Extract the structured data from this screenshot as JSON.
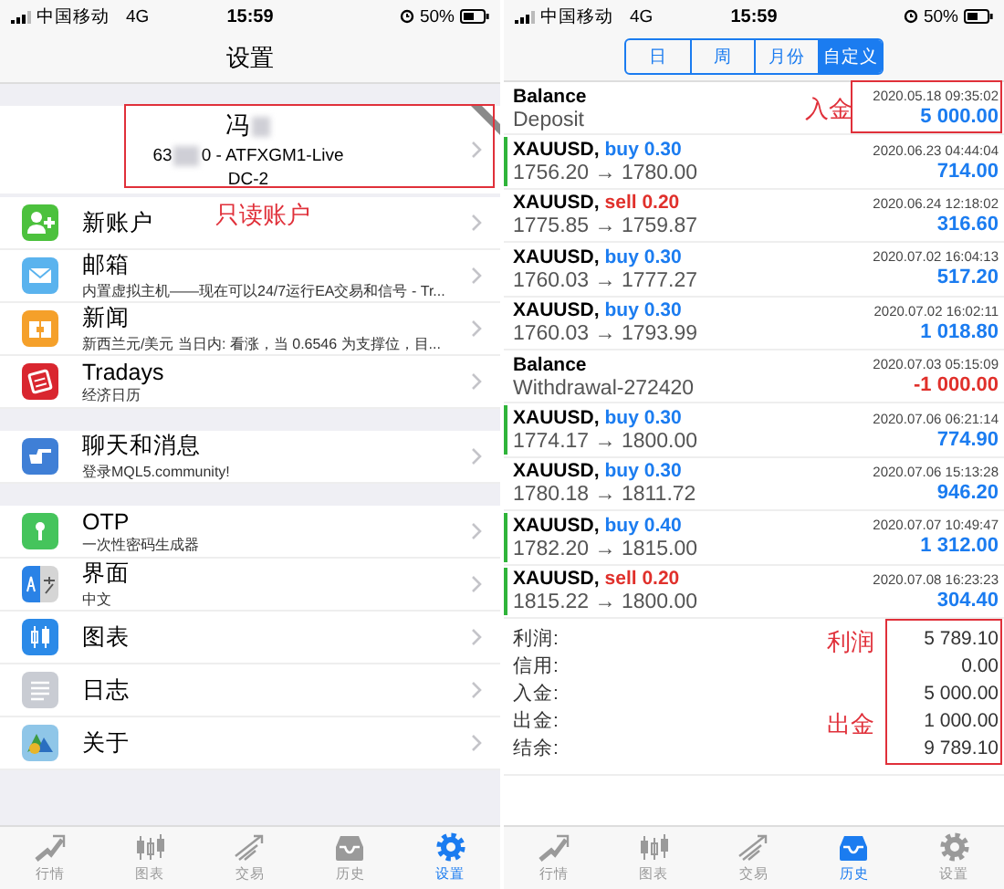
{
  "left_screen": {
    "status_bar": {
      "carrier": "中国移动",
      "network": "4G",
      "time": "15:59",
      "battery": "50%"
    },
    "title": "设置",
    "account": {
      "name": "冯",
      "number_start": "63",
      "number_end": "0 - ATFXGM1-Live",
      "server": "DC-2"
    },
    "account_note": "只读账户",
    "groups": [
      [
        {
          "kind": "new-account",
          "title": "新账户"
        },
        {
          "kind": "mail",
          "title": "邮箱",
          "subtitle": "内置虚拟主机——现在可以24/7运行EA交易和信号 - Tr..."
        },
        {
          "kind": "news",
          "title": "新闻",
          "subtitle": "新西兰元/美元 当日内: 看涨，当 0.6546 为支撑位，目..."
        },
        {
          "kind": "tradays",
          "title": "Tradays",
          "subtitle": "经济日历"
        }
      ],
      [
        {
          "kind": "chat",
          "title": "聊天和消息",
          "subtitle": "登录MQL5.community!"
        }
      ],
      [
        {
          "kind": "otp",
          "title": "OTP",
          "subtitle": "一次性密码生成器"
        },
        {
          "kind": "language",
          "title": "界面",
          "subtitle": "中文"
        },
        {
          "kind": "chart",
          "title": "图表"
        },
        {
          "kind": "log",
          "title": "日志"
        },
        {
          "kind": "about",
          "title": "关于"
        }
      ]
    ],
    "tab_bar": [
      {
        "kind": "market",
        "label": "行情",
        "selected": false
      },
      {
        "kind": "chart",
        "label": "图表",
        "selected": false
      },
      {
        "kind": "trade",
        "label": "交易",
        "selected": false
      },
      {
        "kind": "history",
        "label": "历史",
        "selected": false
      },
      {
        "kind": "settings",
        "label": "设置",
        "selected": true
      }
    ]
  },
  "right_screen": {
    "status_bar": {
      "carrier": "中国移动",
      "network": "4G",
      "time": "15:59",
      "battery": "50%"
    },
    "periods": [
      {
        "label": "日",
        "selected": false
      },
      {
        "label": "周",
        "selected": false
      },
      {
        "label": "月份",
        "selected": false
      },
      {
        "label": "自定义",
        "selected": true
      }
    ],
    "deals": [
      {
        "kind": "balance",
        "title": "Balance",
        "comment": "Deposit",
        "time": "2020.05.18 09:35:02",
        "amount": "5 000.00",
        "negative": false,
        "marked": false
      },
      {
        "kind": "buy",
        "symbol": "XAUUSD,",
        "side": "buy 0.30",
        "prices": "1756.20 → 1780.00",
        "time": "2020.06.23 04:44:04",
        "amount": "714.00",
        "negative": false,
        "marked": true
      },
      {
        "kind": "sell",
        "symbol": "XAUUSD,",
        "side": "sell 0.20",
        "prices": "1775.85 → 1759.87",
        "time": "2020.06.24 12:18:02",
        "amount": "316.60",
        "negative": false,
        "marked": false
      },
      {
        "kind": "buy",
        "symbol": "XAUUSD,",
        "side": "buy 0.30",
        "prices": "1760.03 → 1777.27",
        "time": "2020.07.02 16:04:13",
        "amount": "517.20",
        "negative": false,
        "marked": false
      },
      {
        "kind": "buy",
        "symbol": "XAUUSD,",
        "side": "buy 0.30",
        "prices": "1760.03 → 1793.99",
        "time": "2020.07.02 16:02:11",
        "amount": "1 018.80",
        "negative": false,
        "marked": false
      },
      {
        "kind": "balance",
        "title": "Balance",
        "comment": "Withdrawal-272420",
        "time": "2020.07.03 05:15:09",
        "amount": "-1 000.00",
        "negative": true,
        "marked": false
      },
      {
        "kind": "buy",
        "symbol": "XAUUSD,",
        "side": "buy 0.30",
        "prices": "1774.17 → 1800.00",
        "time": "2020.07.06 06:21:14",
        "amount": "774.90",
        "negative": false,
        "marked": true
      },
      {
        "kind": "buy",
        "symbol": "XAUUSD,",
        "side": "buy 0.30",
        "prices": "1780.18 → 1811.72",
        "time": "2020.07.06 15:13:28",
        "amount": "946.20",
        "negative": false,
        "marked": false
      },
      {
        "kind": "buy",
        "symbol": "XAUUSD,",
        "side": "buy 0.40",
        "prices": "1782.20 → 1815.00",
        "time": "2020.07.07 10:49:47",
        "amount": "1 312.00",
        "negative": false,
        "marked": true
      },
      {
        "kind": "sell",
        "symbol": "XAUUSD,",
        "side": "sell 0.20",
        "prices": "1815.22 → 1800.00",
        "time": "2020.07.08 16:23:23",
        "amount": "304.40",
        "negative": false,
        "marked": true
      }
    ],
    "summary": [
      {
        "label": "利润:",
        "value": "5 789.10"
      },
      {
        "label": "信用:",
        "value": "0.00"
      },
      {
        "label": "入金:",
        "value": "5 000.00"
      },
      {
        "label": "出金:",
        "value": "1 000.00"
      },
      {
        "label": "结余:",
        "value": "9 789.10"
      }
    ],
    "annotation_deposit": "入金",
    "annotation_profit": "利润",
    "annotation_withdrawal": "出金",
    "tab_bar": [
      {
        "kind": "market",
        "label": "行情",
        "selected": false
      },
      {
        "kind": "chart",
        "label": "图表",
        "selected": false
      },
      {
        "kind": "trade",
        "label": "交易",
        "selected": false
      },
      {
        "kind": "history",
        "label": "历史",
        "selected": true
      },
      {
        "kind": "settings",
        "label": "设置",
        "selected": false
      }
    ]
  }
}
